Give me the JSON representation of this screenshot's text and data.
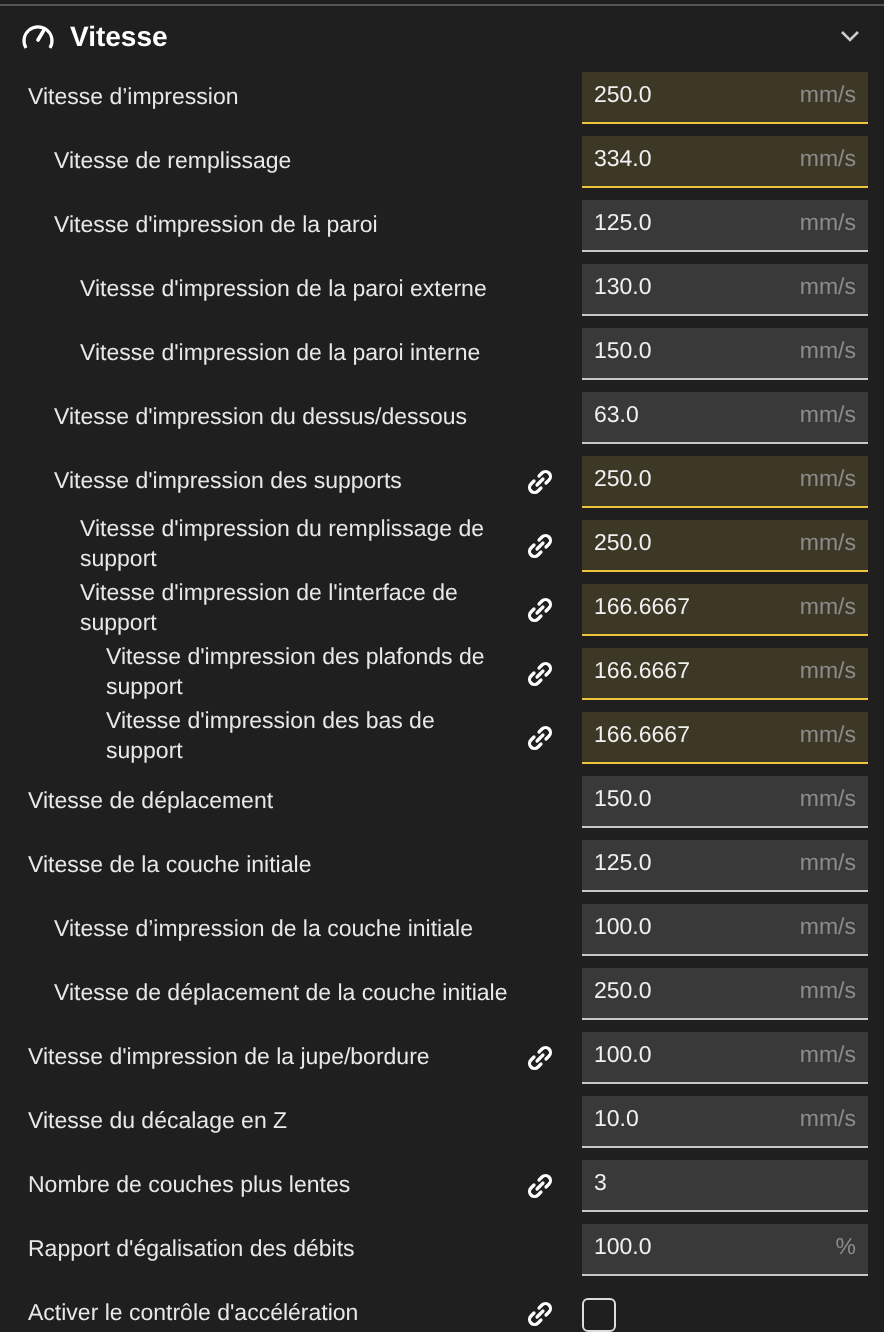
{
  "section": {
    "title": "Vitesse",
    "expanded": true
  },
  "settings": [
    {
      "label": "Vitesse d’impression",
      "value": "250.0",
      "unit": "mm/s",
      "modified": true,
      "linked": false,
      "children": [
        {
          "label": "Vitesse de remplissage",
          "value": "334.0",
          "unit": "mm/s",
          "modified": true,
          "linked": false
        },
        {
          "label": "Vitesse d'impression de la paroi",
          "value": "125.0",
          "unit": "mm/s",
          "modified": false,
          "linked": false,
          "children": [
            {
              "label": "Vitesse d'impression de la paroi externe",
              "value": "130.0",
              "unit": "mm/s",
              "modified": false,
              "linked": false
            },
            {
              "label": "Vitesse d'impression de la paroi interne",
              "value": "150.0",
              "unit": "mm/s",
              "modified": false,
              "linked": false
            }
          ]
        },
        {
          "label": "Vitesse d'impression du dessus/dessous",
          "value": "63.0",
          "unit": "mm/s",
          "modified": false,
          "linked": false
        },
        {
          "label": "Vitesse d'impression des supports",
          "value": "250.0",
          "unit": "mm/s",
          "modified": true,
          "linked": true,
          "children": [
            {
              "label": "Vitesse d'impression du remplissage de support",
              "value": "250.0",
              "unit": "mm/s",
              "modified": true,
              "linked": true
            },
            {
              "label": "Vitesse d'impression de l'interface de support",
              "value": "166.6667",
              "unit": "mm/s",
              "modified": true,
              "linked": true,
              "children": [
                {
                  "label": "Vitesse d'impression des plafonds de support",
                  "value": "166.6667",
                  "unit": "mm/s",
                  "modified": true,
                  "linked": true
                },
                {
                  "label": "Vitesse d'impression des bas de support",
                  "value": "166.6667",
                  "unit": "mm/s",
                  "modified": true,
                  "linked": true
                }
              ]
            }
          ]
        }
      ]
    },
    {
      "label": "Vitesse de déplacement",
      "value": "150.0",
      "unit": "mm/s",
      "modified": false,
      "linked": false
    },
    {
      "label": "Vitesse de la couche initiale",
      "value": "125.0",
      "unit": "mm/s",
      "modified": false,
      "linked": false,
      "children": [
        {
          "label": "Vitesse d’impression de la couche initiale",
          "value": "100.0",
          "unit": "mm/s",
          "modified": false,
          "linked": false
        },
        {
          "label": "Vitesse de déplacement de la couche initiale",
          "value": "250.0",
          "unit": "mm/s",
          "modified": false,
          "linked": false
        }
      ]
    },
    {
      "label": "Vitesse d'impression de la jupe/bordure",
      "value": "100.0",
      "unit": "mm/s",
      "modified": false,
      "linked": true
    },
    {
      "label": "Vitesse du décalage en Z",
      "value": "10.0",
      "unit": "mm/s",
      "modified": false,
      "linked": false
    },
    {
      "label": "Nombre de couches plus lentes",
      "value": "3",
      "modified": false,
      "linked": true
    },
    {
      "label": "Rapport d'égalisation des débits",
      "value": "100.0",
      "unit": "%",
      "modified": false,
      "linked": false
    },
    {
      "label": "Activer le contrôle d'accélération",
      "kind": "checkbox",
      "checked": false,
      "linked": true
    }
  ]
}
